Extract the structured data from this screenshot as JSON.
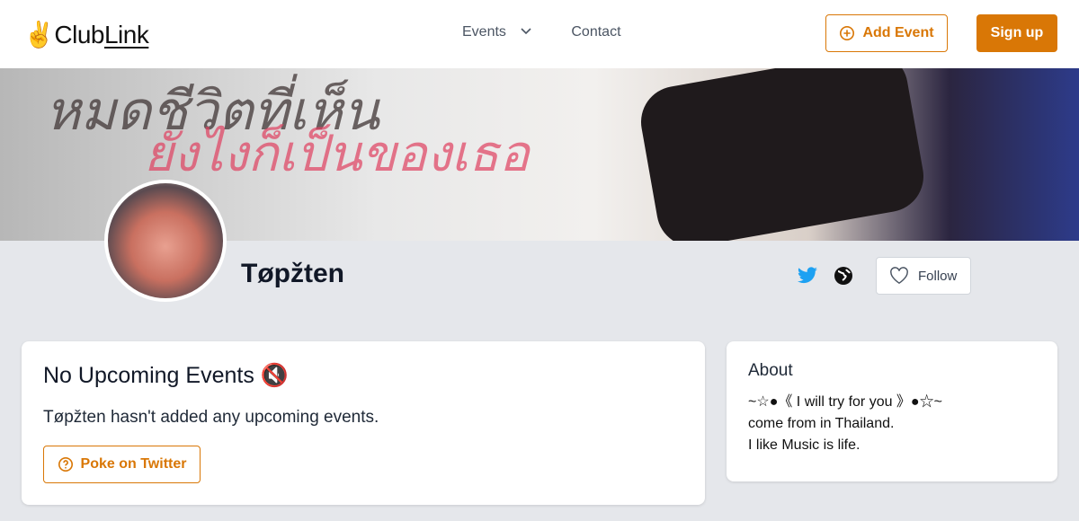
{
  "nav": {
    "logo_emoji": "✌",
    "logo_club": "Club",
    "logo_link": "Link",
    "events": "Events",
    "contact": "Contact",
    "add_event": "Add Event",
    "sign_up": "Sign up"
  },
  "profile": {
    "name": "Tøpžten",
    "follow": "Follow"
  },
  "events_card": {
    "title": "No Upcoming Events",
    "title_emoji": "🔇",
    "message": "Tøpžten hasn't added any upcoming events.",
    "poke": "Poke on Twitter"
  },
  "about": {
    "title": "About",
    "lines": [
      "~☆●《 I will try for you 》●☆~",
      "come from in Thailand.",
      "I like Music is life."
    ]
  },
  "colors": {
    "accent": "#d97706",
    "twitter": "#1da1f2"
  }
}
